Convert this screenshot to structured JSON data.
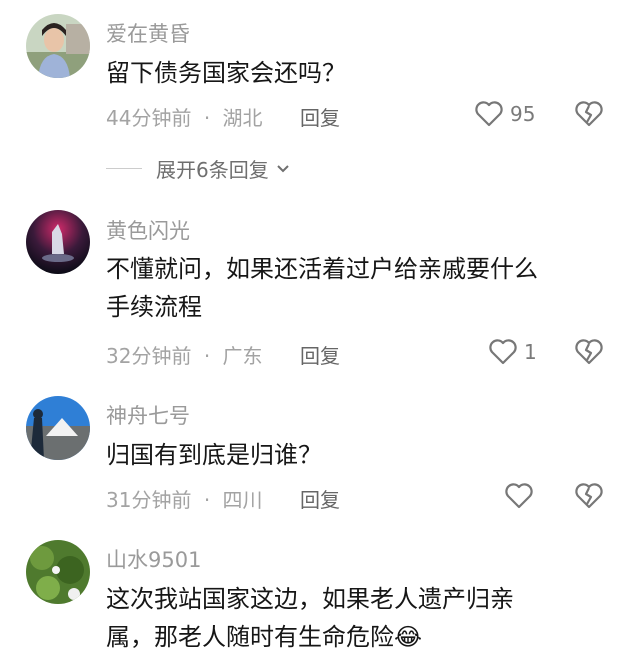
{
  "comments": [
    {
      "username": "爱在黄昏",
      "text": "留下债务国家会还吗？",
      "time": "44分钟前",
      "location": "湖北",
      "reply_label": "回复",
      "likes": "95"
    },
    {
      "username": "黄色闪光",
      "text": "不懂就问，如果还活着过户给亲戚要什么\n手续流程",
      "time": "32分钟前",
      "location": "广东",
      "reply_label": "回复",
      "likes": "1"
    },
    {
      "username": "神舟七号",
      "text": "归国有到底是归谁？",
      "time": "31分钟前",
      "location": "四川",
      "reply_label": "回复",
      "likes": ""
    },
    {
      "username": "山水9501",
      "text": "这次我站国家这边，如果老人遗产归亲\n属，那老人随时有生命危险😂"
    }
  ],
  "expand_replies": "展开6条回复",
  "separator": "·",
  "icons": {
    "like": "heart-outline-icon",
    "dislike": "broken-heart-icon",
    "expand": "chevron-down-icon"
  },
  "colors": {
    "username": "#9a9a9a",
    "text": "#161616",
    "meta": "#a3a3a3"
  }
}
